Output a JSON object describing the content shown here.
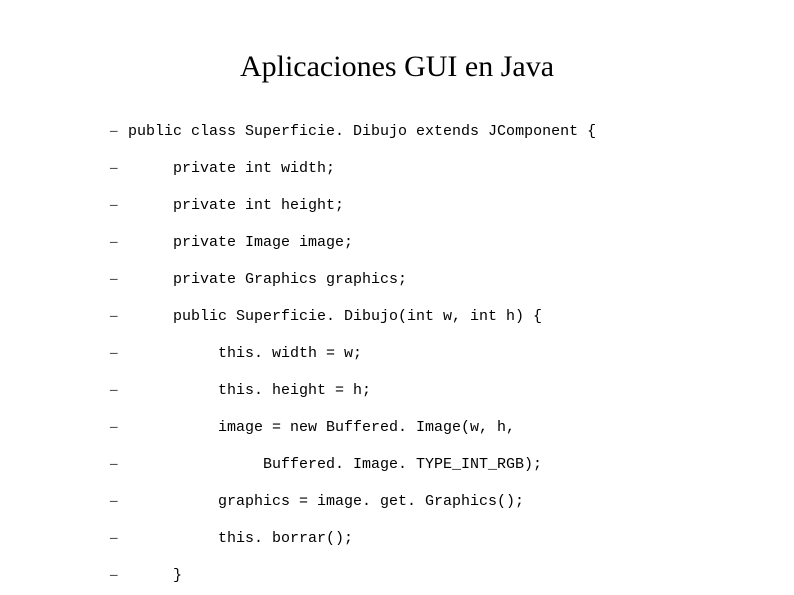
{
  "title": "Aplicaciones GUI en Java",
  "bullet": "–",
  "lines": [
    {
      "indent": 0,
      "text": "public class Superficie. Dibujo extends JComponent {"
    },
    {
      "indent": 1,
      "text": "private int width;"
    },
    {
      "indent": 1,
      "text": "private int height;"
    },
    {
      "indent": 1,
      "text": "private Image image;"
    },
    {
      "indent": 1,
      "text": "private Graphics graphics;"
    },
    {
      "indent": 1,
      "text": "public Superficie. Dibujo(int w, int h) {"
    },
    {
      "indent": 2,
      "text": "this. width = w;"
    },
    {
      "indent": 2,
      "text": "this. height = h;"
    },
    {
      "indent": 2,
      "text": "image = new Buffered. Image(w, h,"
    },
    {
      "indent": 3,
      "text": "Buffered. Image. TYPE_INT_RGB);"
    },
    {
      "indent": 2,
      "text": "graphics = image. get. Graphics();"
    },
    {
      "indent": 2,
      "text": "this. borrar();"
    },
    {
      "indent": 1,
      "text": "}"
    }
  ]
}
